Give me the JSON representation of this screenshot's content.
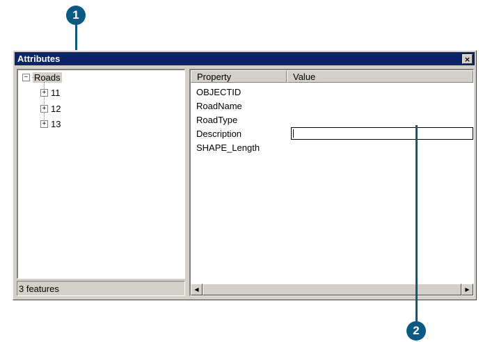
{
  "window": {
    "title": "Attributes",
    "close_label": "×"
  },
  "tree": {
    "root": {
      "label": "Roads",
      "expander": "−"
    },
    "children": [
      {
        "label": "11",
        "expander": "+"
      },
      {
        "label": "12",
        "expander": "+"
      },
      {
        "label": "13",
        "expander": "+"
      }
    ]
  },
  "status": {
    "text": "3 features"
  },
  "table": {
    "columns": [
      "Property",
      "Value"
    ],
    "rows": [
      "OBJECTID",
      "RoadName",
      "RoadType",
      "Description",
      "SHAPE_Length"
    ]
  },
  "callouts": [
    "1",
    "2"
  ],
  "colors": {
    "titlebar": "#0a246a",
    "callout": "#0a5a86",
    "face": "#d4d0c8"
  }
}
